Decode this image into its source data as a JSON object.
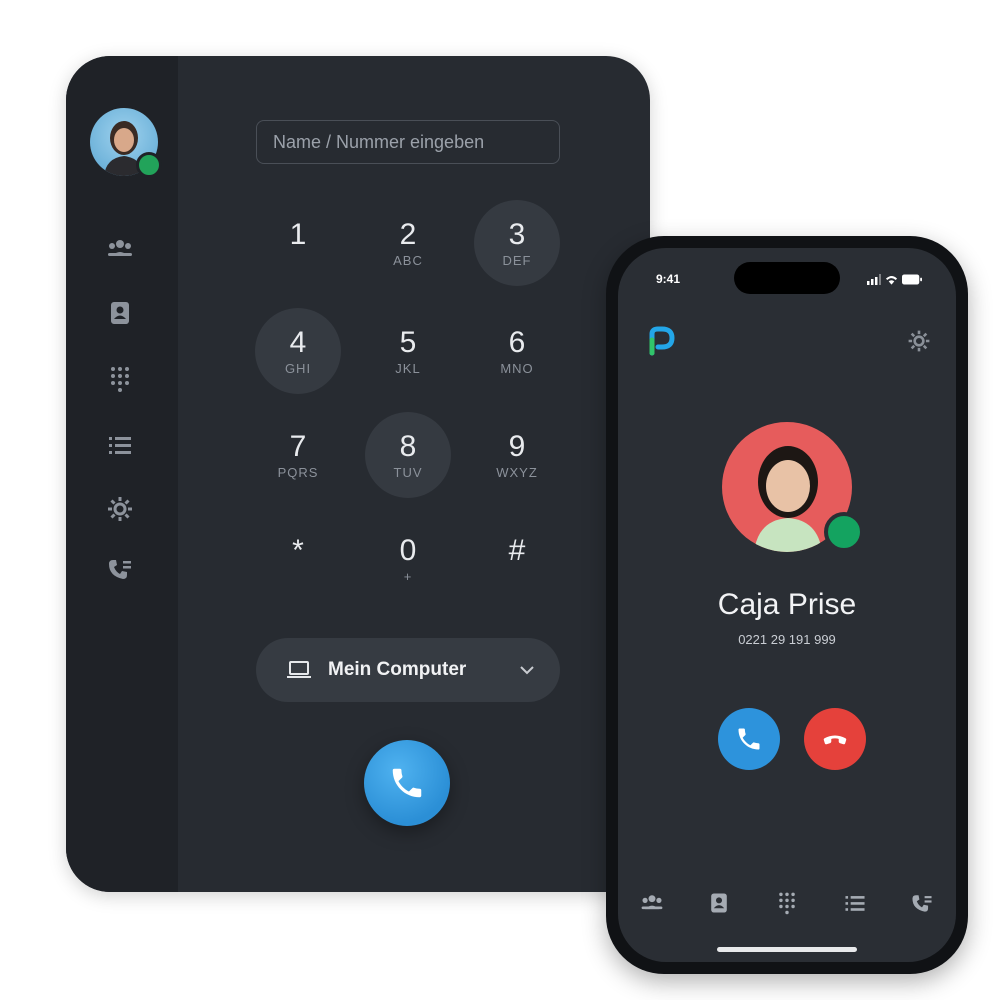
{
  "desktop": {
    "search": {
      "placeholder": "Name / Nummer eingeben"
    },
    "keypad": [
      {
        "digit": "1",
        "letters": ""
      },
      {
        "digit": "2",
        "letters": "ABC"
      },
      {
        "digit": "3",
        "letters": "DEF"
      },
      {
        "digit": "4",
        "letters": "GHI"
      },
      {
        "digit": "5",
        "letters": "JKL"
      },
      {
        "digit": "6",
        "letters": "MNO"
      },
      {
        "digit": "7",
        "letters": "PQRS"
      },
      {
        "digit": "8",
        "letters": "TUV"
      },
      {
        "digit": "9",
        "letters": "WXYZ"
      },
      {
        "digit": "*",
        "letters": ""
      },
      {
        "digit": "0",
        "letters": "+"
      },
      {
        "digit": "#",
        "letters": ""
      }
    ],
    "device_selector": {
      "label": "Mein Computer"
    },
    "sidebar_icons": [
      "team-icon",
      "contacts-icon",
      "dialpad-icon",
      "list-icon",
      "settings-icon",
      "voicemail-icon"
    ],
    "presence_color": "#22a35a",
    "call_button_color": "#2b8fd6"
  },
  "phone": {
    "status_time": "9:41",
    "caller": {
      "name": "Caja Prise",
      "number": "0221 29 191 999"
    },
    "accept_color": "#2d93dc",
    "decline_color": "#e5413b",
    "tabs": [
      "team-icon",
      "contacts-icon",
      "dialpad-icon",
      "list-icon",
      "voicemail-icon"
    ]
  }
}
